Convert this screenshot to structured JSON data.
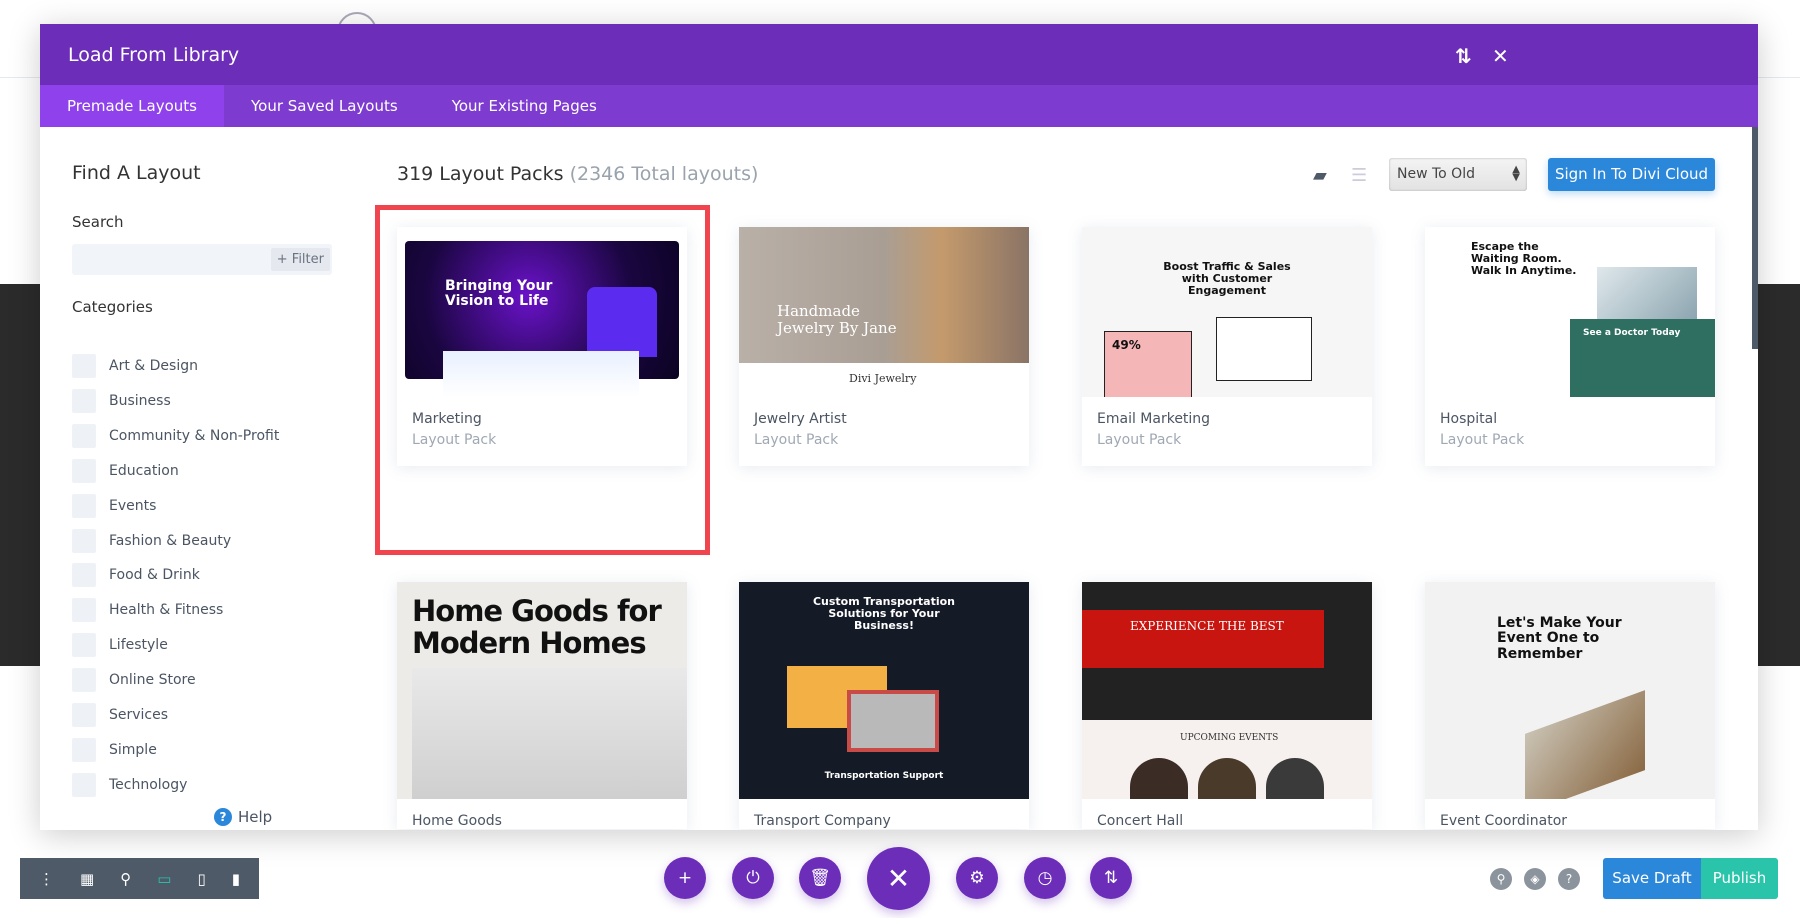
{
  "modal": {
    "title": "Load From Library",
    "tabs": [
      {
        "label": "Premade Layouts",
        "active": true
      },
      {
        "label": "Your Saved Layouts"
      },
      {
        "label": "Your Existing Pages"
      }
    ],
    "icons": [
      "sort-icon",
      "close-icon"
    ]
  },
  "sidebar": {
    "heading": "Find A Layout",
    "search_label": "Search",
    "search_value": "",
    "filter_label": "+ Filter",
    "categories_label": "Categories",
    "categories": [
      "Art & Design",
      "Business",
      "Community & Non-Profit",
      "Education",
      "Events",
      "Fashion & Beauty",
      "Food & Drink",
      "Health & Fitness",
      "Lifestyle",
      "Online Store",
      "Services",
      "Simple",
      "Technology"
    ],
    "help_label": "Help"
  },
  "content": {
    "count": "319 Layout Packs",
    "total": "(2346 Total layouts)",
    "sort_value": "New To Old",
    "signin_label": "Sign In To Divi Cloud",
    "cards": [
      {
        "title": "Marketing",
        "subtitle": "Layout Pack",
        "preview": "Bringing Your Vision to Life",
        "selected": true
      },
      {
        "title": "Jewelry Artist",
        "subtitle": "Layout Pack",
        "preview": "Handmade Jewelry By Jane",
        "preview2": "Divi Jewelry"
      },
      {
        "title": "Email Marketing",
        "subtitle": "Layout Pack",
        "preview": "Boost Traffic & Sales with Customer Engagement",
        "preview2": "49%"
      },
      {
        "title": "Hospital",
        "subtitle": "Layout Pack",
        "preview": "Escape the Waiting Room. Walk In Anytime.",
        "preview2": "See a Doctor Today"
      },
      {
        "title": "Home Goods",
        "preview": "Home Goods for Modern Homes"
      },
      {
        "title": "Transport Company",
        "preview": "Custom Transportation Solutions for Your Business!",
        "preview2": "Transportation Support"
      },
      {
        "title": "Concert Hall",
        "preview": "EXPERIENCE THE BEST",
        "preview2": "UPCOMING EVENTS"
      },
      {
        "title": "Event Coordinator",
        "preview": "Let's Make Your Event One to Remember"
      }
    ]
  },
  "bottom": {
    "save_label": "Save Draft",
    "publish_label": "Publish",
    "colors": {
      "purple": "#6c2eb9",
      "blue": "#2b87da",
      "green": "#29c4a9"
    }
  }
}
